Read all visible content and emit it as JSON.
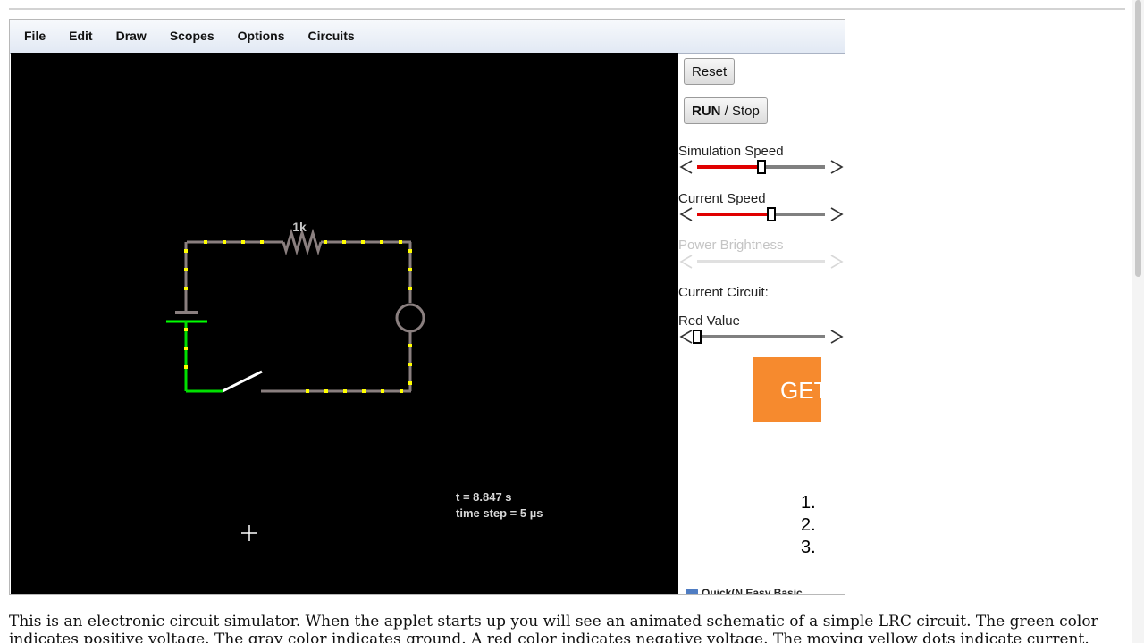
{
  "menu": [
    "File",
    "Edit",
    "Draw",
    "Scopes",
    "Options",
    "Circuits"
  ],
  "canvas": {
    "resistor_label": "1k",
    "time": "t = 8.847 s",
    "time_step": "time step = 5 µs"
  },
  "sidebar": {
    "reset_label": "Reset",
    "run_bold": "RUN",
    "run_rest": " / Stop",
    "simulation_speed": {
      "label": "Simulation Speed",
      "value": 0.5
    },
    "current_speed": {
      "label": "Current Speed",
      "value": 0.58
    },
    "power_brightness": {
      "label": "Power Brightness",
      "disabled": true
    },
    "current_circuit_label": "Current Circuit:",
    "red_value": {
      "label": "Red Value",
      "value": 0.0
    }
  },
  "ad": {
    "text": "GET"
  },
  "numbered_list": [
    "1.",
    "2.",
    "3."
  ],
  "quick_link": "Quick(N Easy Basic",
  "description": "This is an electronic circuit simulator.  When the applet starts up you will see an animated schematic of a simple LRC circuit. The green color indicates positive voltage.  The gray color indicates ground.  A red color indicates negative voltage.  The moving yellow dots indicate current.",
  "colors": {
    "positive_wire": "#00ff00",
    "ground_wire": "#808080",
    "current_dot": "#ffff00",
    "slider_fill": "#e00000",
    "ad_background": "#f68a2e"
  }
}
